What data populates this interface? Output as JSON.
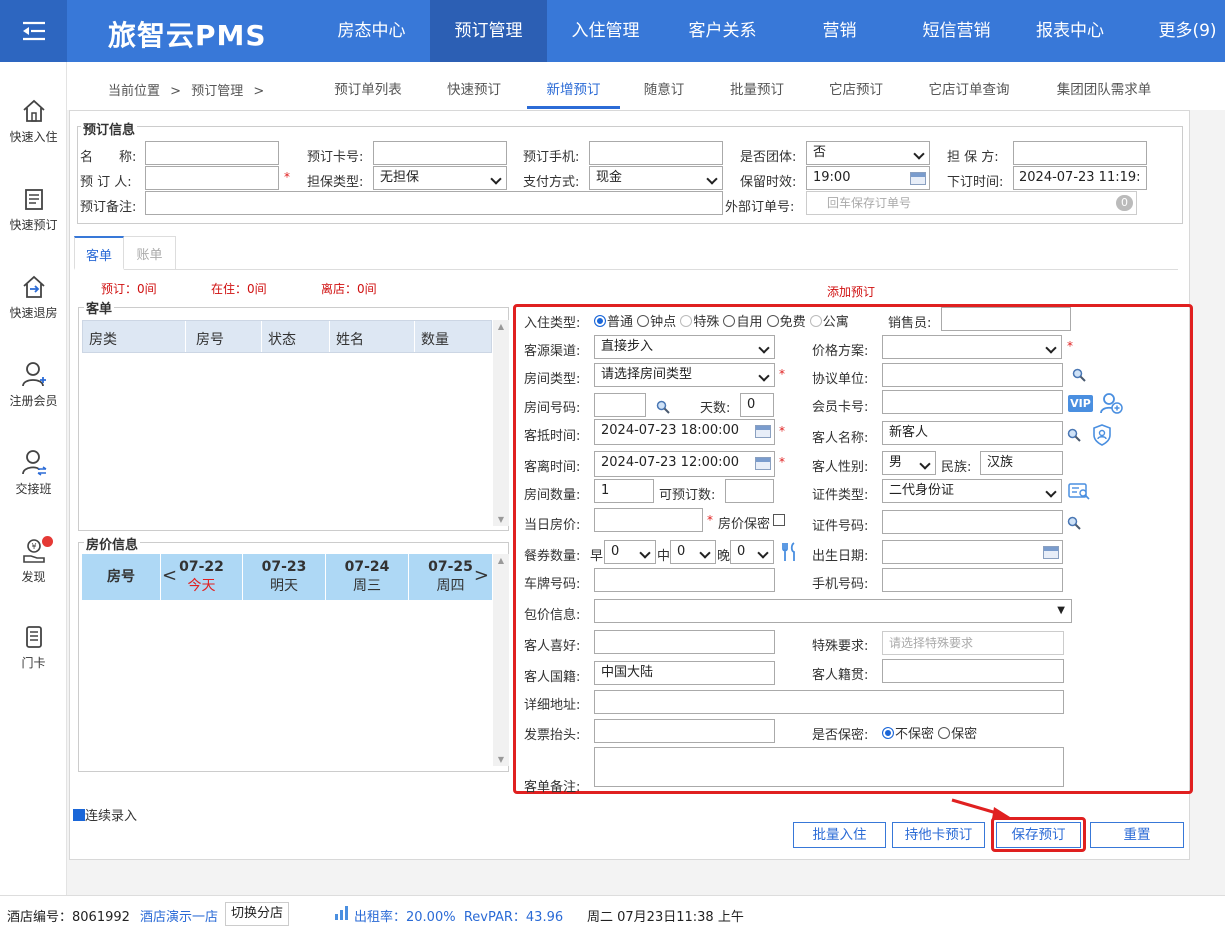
{
  "app": {
    "brand": "旅智云PMS"
  },
  "nav": [
    {
      "label": "房态中心"
    },
    {
      "label": "预订管理"
    },
    {
      "label": "入住管理"
    },
    {
      "label": "客户关系"
    },
    {
      "label": "营销"
    },
    {
      "label": "短信营销"
    },
    {
      "label": "报表中心"
    },
    {
      "label": "更多(9)"
    }
  ],
  "sidebar": [
    {
      "label": "快速入住"
    },
    {
      "label": "快速预订"
    },
    {
      "label": "快速退房"
    },
    {
      "label": "注册会员"
    },
    {
      "label": "交接班"
    },
    {
      "label": "发现"
    },
    {
      "label": "门卡"
    }
  ],
  "breadcrumb": {
    "label": "当前位置",
    "sep": ">",
    "page": "预订管理",
    "sep2": ">"
  },
  "subtabs": [
    {
      "label": "预订单列表"
    },
    {
      "label": "快速预订"
    },
    {
      "label": "新增预订"
    },
    {
      "label": "随意订"
    },
    {
      "label": "批量预订"
    },
    {
      "label": "它店预订"
    },
    {
      "label": "它店订单查询"
    },
    {
      "label": "集团团队需求单"
    }
  ],
  "booking_info": {
    "legend": "预订信息",
    "name_label": "名　　称:",
    "card_no_label": "预订卡号:",
    "phone_label": "预订手机:",
    "is_group_label": "是否团体:",
    "is_group_value": "否",
    "guarantor_label": "担 保 方:",
    "booker_label": "预 订 人:",
    "guarantee_type_label": "担保类型:",
    "guarantee_type_value": "无担保",
    "pay_method_label": "支付方式:",
    "pay_method_value": "现金",
    "hold_label": "保留时效:",
    "hold_value": "19:00",
    "order_time_label": "下订时间:",
    "order_time_value": "2024-07-23 11:19:",
    "remark_label": "预订备注:",
    "ext_order_label": "外部订单号:",
    "ext_order_placeholder": "回车保存订单号",
    "ext_order_count": "0"
  },
  "tabs": [
    {
      "label": "客单"
    },
    {
      "label": "账单"
    }
  ],
  "stats": {
    "booked": "预订：0间",
    "checked_in": "在住：0间",
    "departing": "离店：0间"
  },
  "add_booking": "添加预订",
  "guest_list": {
    "legend": "客单",
    "columns": [
      "房类",
      "房号",
      "状态",
      "姓名",
      "数量"
    ]
  },
  "rate_info": {
    "legend": "房价信息",
    "room_label": "房号",
    "prev": "<",
    "next": ">",
    "dates": [
      {
        "date": "07-22",
        "day": "今天"
      },
      {
        "date": "07-23",
        "day": "明天"
      },
      {
        "date": "07-24",
        "day": "周三"
      },
      {
        "date": "07-25",
        "day": "周四"
      }
    ]
  },
  "form": {
    "checkin_type_label": "入住类型:",
    "checkin_types": [
      "普通",
      "钟点",
      "特殊",
      "自用",
      "免费",
      "公寓"
    ],
    "sales_label": "销售员:",
    "channel_label": "客源渠道:",
    "channel_value": "直接步入",
    "price_plan_label": "价格方案:",
    "room_type_label": "房间类型:",
    "room_type_value": "请选择房间类型",
    "agreement_label": "协议单位:",
    "room_no_label": "房间号码:",
    "days_label": "天数:",
    "days_value": "0",
    "member_card_label": "会员卡号:",
    "vip": "VIP",
    "arrive_label": "客抵时间:",
    "arrive_value": "2024-07-23 18:00:00",
    "guest_name_label": "客人名称:",
    "guest_name_value": "新客人",
    "depart_label": "客离时间:",
    "depart_value": "2024-07-23 12:00:00",
    "gender_label": "客人性别:",
    "gender_value": "男",
    "ethnic_label": "民族:",
    "ethnic_value": "汉族",
    "room_count_label": "房间数量:",
    "room_count_value": "1",
    "available_label": "可预订数:",
    "id_type_label": "证件类型:",
    "id_type_value": "二代身份证",
    "day_price_label": "当日房价:",
    "price_secret_label": "房价保密",
    "id_no_label": "证件号码:",
    "meal_label": "餐券数量:",
    "breakfast_label": "早",
    "breakfast_value": "0",
    "lunch_label": "中",
    "lunch_value": "0",
    "dinner_label": "晚",
    "dinner_value": "0",
    "birth_label": "出生日期:",
    "plate_label": "车牌号码:",
    "mobile_label": "手机号码:",
    "package_label": "包价信息:",
    "pref_label": "客人喜好:",
    "special_label": "特殊要求:",
    "special_placeholder": "请选择特殊要求",
    "nationality_label": "客人国籍:",
    "nationality_value": "中国大陆",
    "native_label": "客人籍贯:",
    "address_label": "详细地址:",
    "invoice_label": "发票抬头:",
    "secret_label": "是否保密:",
    "secret_options": [
      "不保密",
      "保密"
    ],
    "remark_label": "客单备注:"
  },
  "continuous": "连续录入",
  "buttons": {
    "batch_checkin": "批量入住",
    "other_card": "持他卡预订",
    "save": "保存预订",
    "reset": "重置"
  },
  "statusbar": {
    "hotel_no": "酒店编号：8061992",
    "hotel_name": "酒店演示一店",
    "switch": "切换分店",
    "occupancy": "出租率：20.00%  RevPAR：43.96",
    "datetime": "周二 07月23日11:38 上午"
  },
  "colors": {
    "primary": "#3878d8",
    "highlight": "#e02020",
    "header_blue": "#aed8f5"
  }
}
